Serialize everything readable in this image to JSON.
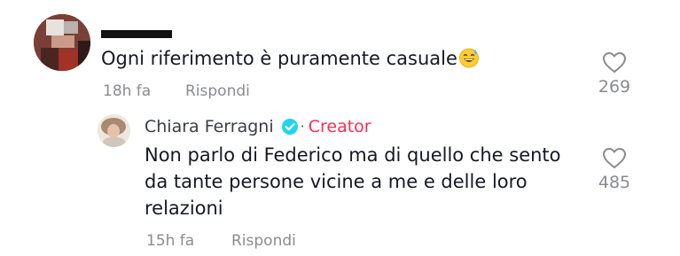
{
  "comment": {
    "username": "",
    "text": "Ogni riferimento è puramente casuale",
    "emoji": "grinning-sweat-emoji",
    "time": "18h fa",
    "reply_label": "Rispondi",
    "likes": "269"
  },
  "reply": {
    "username": "Chiara Ferragni",
    "separator": "·",
    "badge": "Creator",
    "text_lines": [
      "Non parlo di Federico ma di quello che sento",
      "da tante persone vicine a me e delle loro",
      "relazioni"
    ],
    "time": "15h fa",
    "reply_label": "Rispondi",
    "likes": "485"
  },
  "colors": {
    "text": "#161823",
    "muted": "#8a8b91",
    "creator": "#fe2c55",
    "verified": "#20d5ec"
  }
}
